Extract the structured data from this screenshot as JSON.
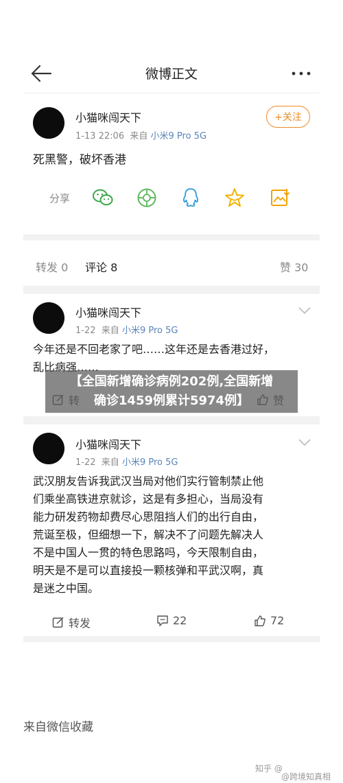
{
  "topbar": {
    "title": "微博正文"
  },
  "post": {
    "username": "小猫咪闯天下",
    "time": "1-13 22:06",
    "from": "来自",
    "device": "小米9 Pro 5G",
    "follow_label": "+关注",
    "text": "死黑警，破坏香港",
    "share_label": "分享"
  },
  "stats": {
    "reposts": "转发 0",
    "comments": "评论 8",
    "likes": "赞 30"
  },
  "comments": [
    {
      "username": "小猫咪闯天下",
      "time": "1-22",
      "from": "来自",
      "device": "小米9 Pro 5G",
      "line1": "今年还是不回老家了吧……这年还是去香港过好，",
      "line2": "乱比病强……",
      "repost_partial": "转",
      "like_partial": "赞"
    },
    {
      "username": "小猫咪闯天下",
      "time": "1-22",
      "from": "来自",
      "device": "小米9 Pro 5G",
      "lines": [
        "武汉朋友告诉我武汉当局对他们实行管制禁止他",
        "们乘坐高铁进京就诊，这是有多担心，当局没有",
        "能力研发药物却费尽心思阻挡人们的出行自由，",
        "荒诞至极，但细想一下，解决不了问题先解决人",
        "不是中国人一贯的特色思路吗，今天限制自由，",
        "明天是不是可以直接投一颗核弹和平武汉啊，真",
        "是迷之中国。"
      ],
      "repost_label": "转发",
      "comment_count": "22",
      "like_count": "72"
    }
  ],
  "footer": "来自微信收藏",
  "banner": {
    "line1": "【全国新增确诊病例202例,全国新增",
    "line2": "确诊1459例累计5974例】"
  },
  "watermark": {
    "left": "知乎 @",
    "right": "@跨境知真相"
  },
  "colors": {
    "accent": "#f08a24",
    "device_link": "#5a84b8",
    "wechat": "#3aa64c",
    "moments": "#5cb85c",
    "qq": "#2f9bd8",
    "favorite": "#f2b300",
    "save": "#f2a100"
  },
  "icons": [
    "back-arrow-icon",
    "more-dots-icon",
    "wechat-icon",
    "moments-icon",
    "qq-icon",
    "favorite-star-icon",
    "save-image-icon",
    "chevron-down-icon",
    "repost-icon",
    "comment-icon",
    "thumbs-up-icon"
  ]
}
